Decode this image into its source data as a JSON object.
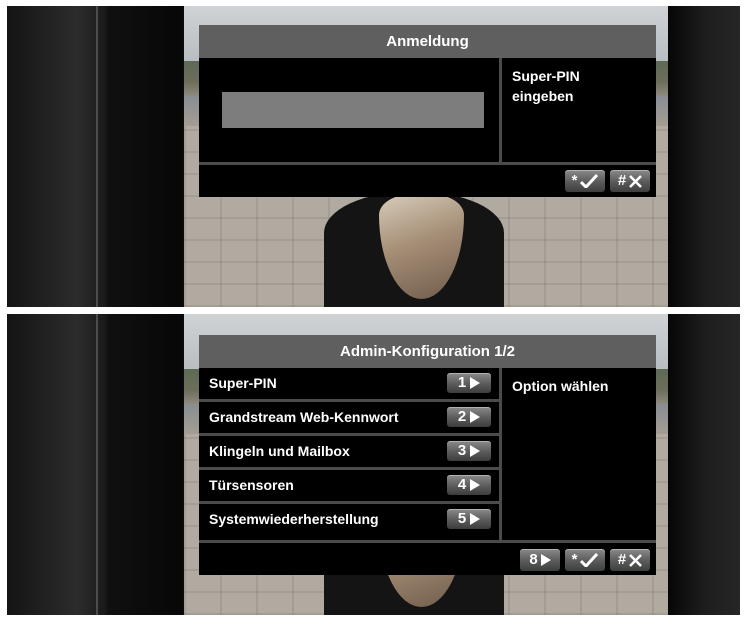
{
  "login_screen": {
    "title": "Anmeldung",
    "prompt_line1": "Super-PIN",
    "prompt_line2": "eingeben",
    "pin_value": "",
    "confirm_key": "*",
    "cancel_key": "#"
  },
  "admin_screen": {
    "title": "Admin-Konfiguration 1/2",
    "hint": "Option wählen",
    "items": [
      {
        "label": "Super-PIN",
        "key": "1"
      },
      {
        "label": "Grandstream Web-Kennwort",
        "key": "2"
      },
      {
        "label": "Klingeln und Mailbox",
        "key": "3"
      },
      {
        "label": "Türsensoren",
        "key": "4"
      },
      {
        "label": "Systemwiederherstellung",
        "key": "5"
      }
    ],
    "next_page_key": "8",
    "confirm_key": "*",
    "cancel_key": "#"
  },
  "colors": {
    "title_bar": "#5f5f5f",
    "dialog_bg": "#000000",
    "divider": "#4b4b4b",
    "text": "#ffffff",
    "input_fill": "#7d7d7d"
  }
}
